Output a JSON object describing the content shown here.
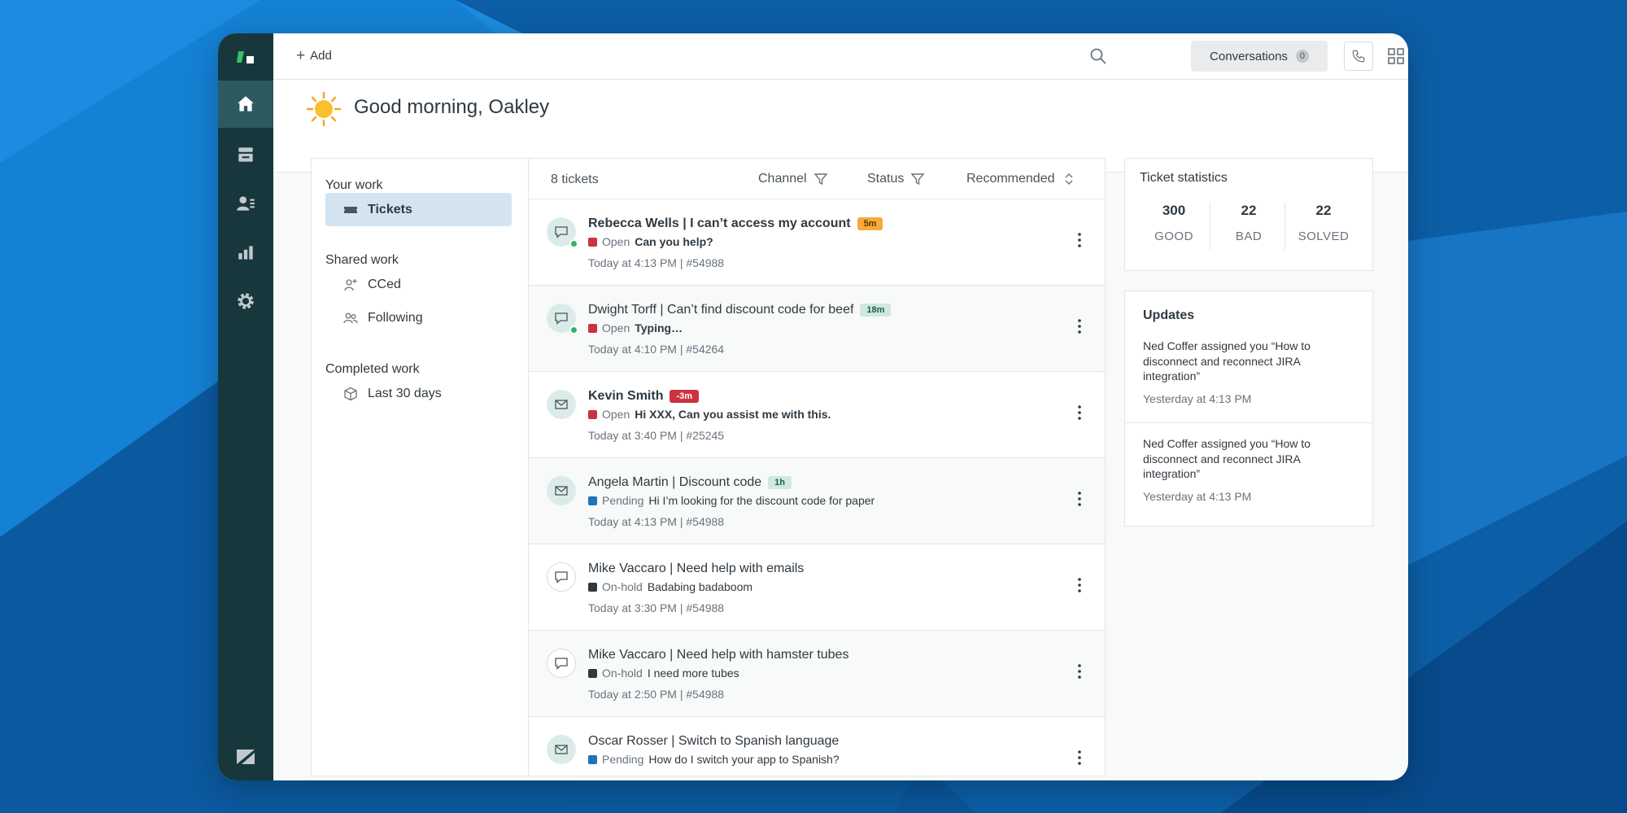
{
  "topbar": {
    "add_label": "Add",
    "conversations_label": "Conversations",
    "conversations_count": "0"
  },
  "greeting": "Good morning, Oakley",
  "sidebar": {
    "your_work_title": "Your work",
    "shared_work_title": "Shared work",
    "completed_work_title": "Completed work",
    "items": [
      {
        "label": "Tickets",
        "icon": "ticket-icon"
      },
      {
        "label": "CCed",
        "icon": "person-add-icon"
      },
      {
        "label": "Following",
        "icon": "people-icon"
      },
      {
        "label": "Last 30 days",
        "icon": "cube-icon"
      }
    ]
  },
  "list": {
    "ticket_count": "8 tickets",
    "filters": [
      {
        "label": "Channel",
        "icon": "filter-icon"
      },
      {
        "label": "Status",
        "icon": "filter-icon"
      },
      {
        "label": "Recommended",
        "icon": "sort-icon"
      }
    ]
  },
  "tickets": [
    {
      "title": "Rebecca Wells | I can’t access my account",
      "badge": "5m",
      "badge_style": "orange",
      "status": "Open",
      "status_color": "#cc3340",
      "snippet": "Can you help?",
      "meta": "Today at 4:13 PM | #54988",
      "channel_icon": "chat-icon",
      "online": true
    },
    {
      "title": "Dwight Torff | Can’t find discount code for beef",
      "badge": "18m",
      "badge_style": "green",
      "status": "Open",
      "status_color": "#cc3340",
      "snippet": "Typing…",
      "meta": "Today at 4:10 PM | #54264",
      "channel_icon": "chat-icon",
      "online": true
    },
    {
      "title": "Kevin Smith",
      "badge": "-3m",
      "badge_style": "red",
      "status": "Open",
      "status_color": "#cc3340",
      "snippet": "Hi XXX, Can you assist me with this.",
      "meta": "Today at 3:40 PM | #25245",
      "channel_icon": "mail-icon",
      "online": false
    },
    {
      "title": "Angela Martin | Discount code",
      "badge": "1h",
      "badge_style": "green",
      "status": "Pending",
      "status_color": "#1f73b7",
      "snippet": "Hi I’m looking for the discount code for paper",
      "meta": "Today at 4:13 PM | #54988",
      "channel_icon": "mail-icon",
      "online": false
    },
    {
      "title": "Mike Vaccaro | Need help with emails",
      "badge": "",
      "badge_style": "",
      "status": "On-hold",
      "status_color": "#2f3941",
      "snippet": "Badabing badaboom",
      "meta": "Today at 3:30 PM | #54988",
      "channel_icon": "chat-icon",
      "online": false
    },
    {
      "title": "Mike Vaccaro | Need help with hamster tubes",
      "badge": "",
      "badge_style": "",
      "status": "On-hold",
      "status_color": "#2f3941",
      "snippet": "I need more tubes",
      "meta": "Today at 2:50 PM | #54988",
      "channel_icon": "chat-icon",
      "online": false
    },
    {
      "title": "Oscar Rosser | Switch to Spanish language",
      "badge": "",
      "badge_style": "",
      "status": "Pending",
      "status_color": "#1f73b7",
      "snippet": "How do I switch your app to Spanish?",
      "meta": "",
      "channel_icon": "mail-icon",
      "online": false
    }
  ],
  "stats": {
    "title": "Ticket statistics",
    "items": [
      {
        "value": "300",
        "label": "GOOD"
      },
      {
        "value": "22",
        "label": "BAD"
      },
      {
        "value": "22",
        "label": "SOLVED"
      }
    ]
  },
  "updates": {
    "title": "Updates",
    "items": [
      {
        "message": "Ned Coffer assigned you “How to disconnect and reconnect JIRA integration”",
        "when": "Yesterday at 4:13 PM"
      },
      {
        "message": "Ned Coffer assigned you “How to disconnect and reconnect JIRA integration”",
        "when": "Yesterday at 4:13 PM"
      }
    ]
  },
  "colors": {
    "rail": "#17373d",
    "accent_blue": "#1f73b7",
    "online_green": "#2fb56b"
  }
}
